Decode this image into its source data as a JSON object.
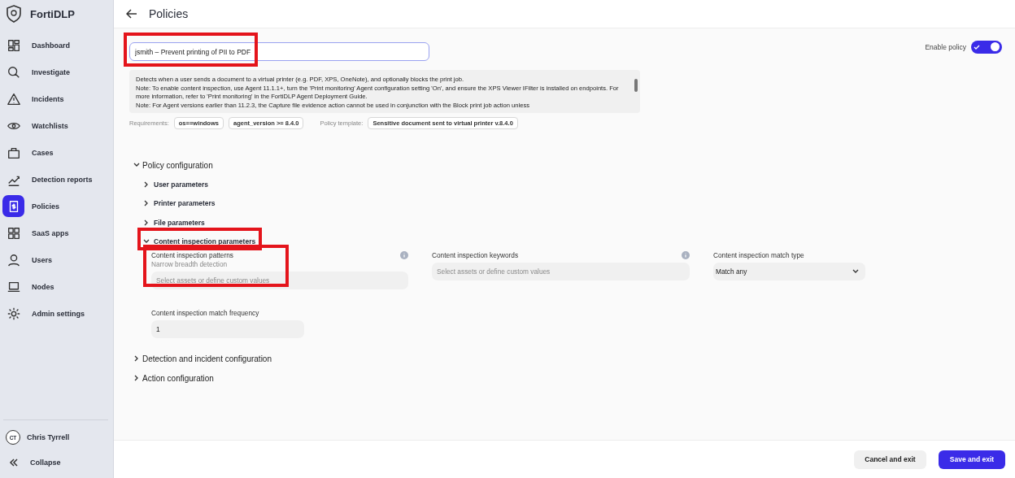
{
  "sidebar": {
    "brand": "FortiDLP",
    "items": [
      {
        "label": "Dashboard",
        "selected": false
      },
      {
        "label": "Investigate",
        "selected": false
      },
      {
        "label": "Incidents",
        "selected": false
      },
      {
        "label": "Watchlists",
        "selected": false
      },
      {
        "label": "Cases",
        "selected": false
      },
      {
        "label": "Detection reports",
        "selected": false
      },
      {
        "label": "Policies",
        "selected": true
      },
      {
        "label": "SaaS apps",
        "selected": false
      },
      {
        "label": "Users",
        "selected": false
      },
      {
        "label": "Nodes",
        "selected": false
      },
      {
        "label": "Admin settings",
        "selected": false
      }
    ],
    "user": {
      "initials": "CT",
      "name": "Chris Tyrrell"
    },
    "collapse": "Collapse"
  },
  "header": {
    "title": "Policies"
  },
  "policy": {
    "name": "jsmith – Prevent printing of PII to PDF",
    "name_highlighted": true,
    "enable_label": "Enable policy",
    "enabled": true,
    "description": [
      "Detects when a user sends a document to a virtual printer (e.g. PDF, XPS, OneNote), and optionally blocks the print job.",
      "Note: To enable content inspection, use Agent 11.1.1+, turn the 'Print monitoring' Agent configuration setting 'On', and ensure the XPS Viewer IFilter is installed on endpoints. For more information, refer to 'Print monitoring' in the FortiDLP Agent Deployment Guide.",
      "Note: For Agent versions earlier than 11.2.3, the Capture file evidence action cannot be used in conjunction with the Block print job action unless"
    ],
    "requirements_label": "Requirements:",
    "requirements": [
      "os==windows",
      "agent_version >= 8.4.0"
    ],
    "template_label": "Policy template:",
    "template": "Sensitive document sent to virtual printer v.8.4.0"
  },
  "config": {
    "title": "Policy configuration",
    "expanded": true,
    "sections": [
      {
        "label": "User parameters",
        "expanded": false,
        "highlighted": false
      },
      {
        "label": "Printer parameters",
        "expanded": false,
        "highlighted": false
      },
      {
        "label": "File parameters",
        "expanded": false,
        "highlighted": false
      },
      {
        "label": "Content inspection parameters",
        "expanded": true,
        "highlighted": true
      }
    ],
    "fields": [
      {
        "kind": "multiselect",
        "label": "Content inspection patterns",
        "hint": "Narrow breadth detection",
        "placeholder": "Select assets or define custom values",
        "info": true,
        "highlighted": true
      },
      {
        "kind": "multiselect",
        "label": "Content inspection keywords",
        "placeholder": "Select assets or define custom values",
        "info": true
      },
      {
        "kind": "select",
        "label": "Content inspection match type",
        "value": "Match any"
      },
      {
        "kind": "number",
        "label": "Content inspection match frequency",
        "value": "1"
      }
    ]
  },
  "other_sections": [
    {
      "label": "Detection and incident configuration",
      "expanded": false
    },
    {
      "label": "Action configuration",
      "expanded": false
    }
  ],
  "footer": {
    "buttons": [
      {
        "label": "Cancel and exit",
        "kind": "secondary"
      },
      {
        "label": "Save and exit",
        "kind": "primary"
      }
    ]
  }
}
